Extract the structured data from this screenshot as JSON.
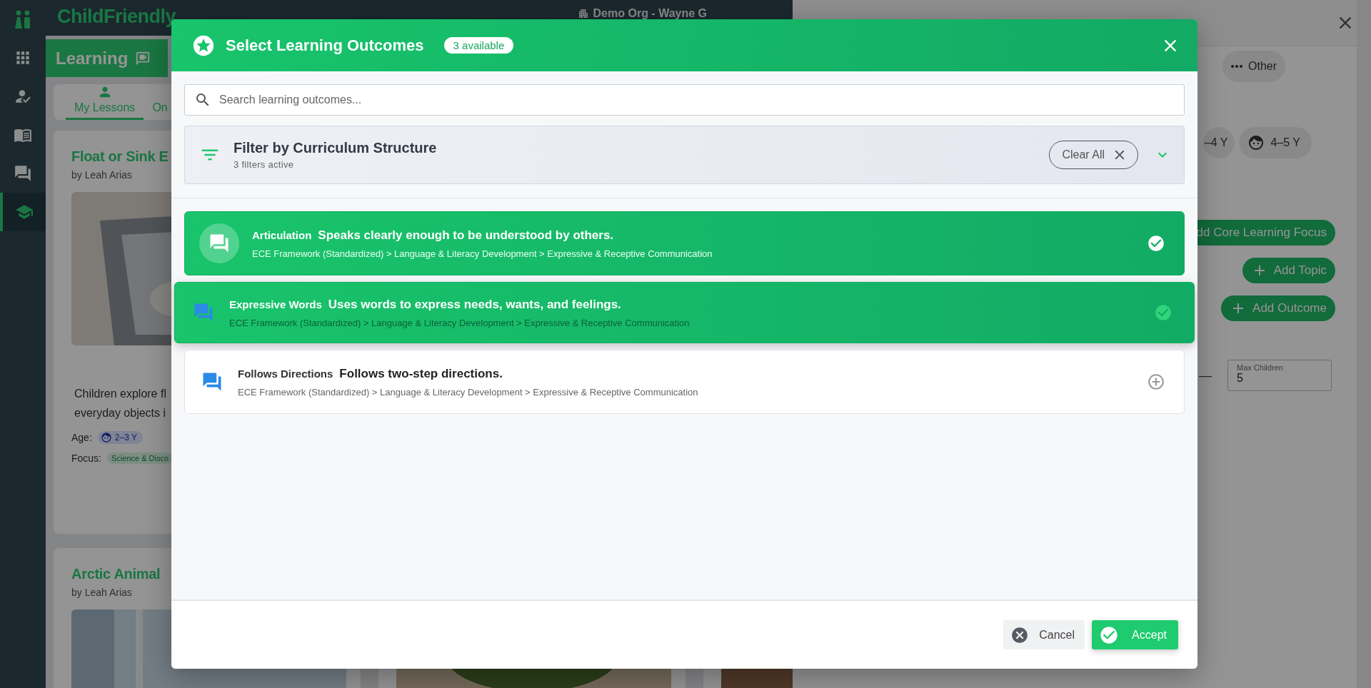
{
  "app": {
    "logo": "ChildFriendly",
    "org": "Demo Org - Wayne G"
  },
  "sidebar": {
    "items": [
      {
        "selected": false
      },
      {
        "selected": false
      },
      {
        "selected": false
      },
      {
        "selected": false
      },
      {
        "selected": true
      }
    ]
  },
  "section": {
    "title": "Learning"
  },
  "tabs": [
    {
      "label": "My Lessons",
      "selected": true
    },
    {
      "label": "On",
      "selected": false
    }
  ],
  "lessons": [
    {
      "kind": "card",
      "title": "Float or Sink E",
      "author": "by Leah Arias",
      "description": [
        "Children explore fl",
        "everyday objects i"
      ],
      "age_label": "Age:",
      "age": "2–3 Y",
      "focus_label": "Focus:",
      "focus": "Science & Disco"
    },
    {
      "kind": "card",
      "title": "Arctic Animal",
      "author": "by Leah Arias"
    },
    {
      "kind": "picture"
    },
    {
      "kind": "picture"
    }
  ],
  "drawer": {
    "chips": [
      {
        "label": "Other"
      }
    ],
    "age_chips": [
      {
        "label": "–4 Y",
        "kind": "plain"
      },
      {
        "label": "4–5 Y",
        "kind": "face"
      }
    ],
    "buttons": [
      {
        "label": "dd Core Learning Focus",
        "kind": "plain"
      },
      {
        "label": "Add Topic",
        "kind": "add"
      },
      {
        "label": "Add Outcome",
        "kind": "add"
      }
    ],
    "range_separator": "—",
    "max_children": {
      "label": "Max Children",
      "value": "5"
    }
  },
  "modal": {
    "title": "Select Learning Outcomes",
    "badge": "3 available",
    "search": {
      "placeholder": "Search learning outcomes..."
    },
    "filter": {
      "title": "Filter by Curriculum Structure",
      "subtitle": "3 filters active",
      "clear": "Clear All",
      "expanded": false
    },
    "outcomes": [
      {
        "name": "Articulation",
        "description": "Speaks clearly enough to be understood by others.",
        "path": "ECE Framework (Standardized) > Language & Literacy Development > Expressive & Receptive Communication",
        "selected": true,
        "hovered": false
      },
      {
        "name": "Expressive Words",
        "description": "Uses words to express needs, wants, and feelings.",
        "path": "ECE Framework (Standardized) > Language & Literacy Development > Expressive & Receptive Communication",
        "selected": true,
        "hovered": true
      },
      {
        "name": "Follows Directions",
        "description": "Follows two-step directions.",
        "path": "ECE Framework (Standardized) > Language & Literacy Development > Expressive & Receptive Communication",
        "selected": false,
        "hovered": false
      }
    ],
    "cancel": "Cancel",
    "accept": "Accept"
  }
}
